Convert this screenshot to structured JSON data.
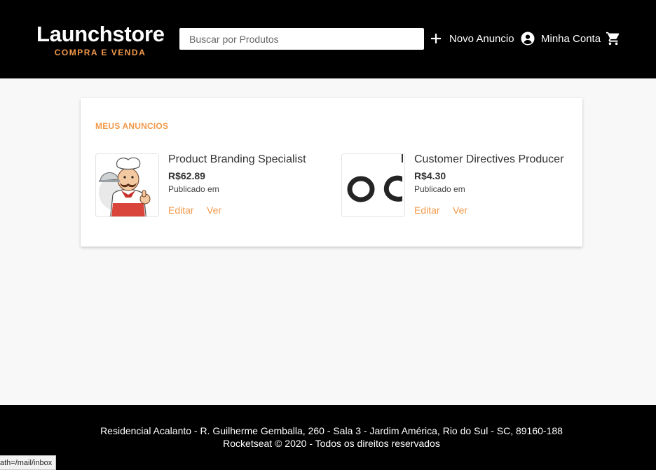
{
  "header": {
    "logo_title": "Launchstore",
    "logo_subtitle": "COMPRA E VENDA",
    "search_placeholder": "Buscar por Produtos",
    "new_ad_label": "Novo Anuncio",
    "account_label": "Minha Conta",
    "icons": {
      "new_ad": "plus-icon",
      "account": "account-circle-icon",
      "cart": "shopping-cart-icon"
    }
  },
  "main": {
    "section_title": "MEUS ANUNCIOS",
    "products": [
      {
        "name": "Product Branding Specialist",
        "price": "R$62.89",
        "published": "Publicado em",
        "edit_label": "Editar",
        "view_label": "Ver",
        "image": "chef-illustration"
      },
      {
        "name": "Customer Directives Producer",
        "price": "R$4.30",
        "published": "Publicado em",
        "edit_label": "Editar",
        "view_label": "Ver",
        "image": "text-fragment-image"
      }
    ]
  },
  "footer": {
    "address": "Residencial Acalanto - R. Guilherme Gemballa, 260 - Sala 3 - Jardim América, Rio do Sul - SC, 89160-188",
    "copyright": "Rocketseat © 2020 - Todos os direitos reservados"
  },
  "status_bar": {
    "url": "ath=/mail/inbox"
  },
  "colors": {
    "accent": "#f2994a",
    "header_bg": "#000000",
    "page_bg": "#f8f8f8"
  }
}
